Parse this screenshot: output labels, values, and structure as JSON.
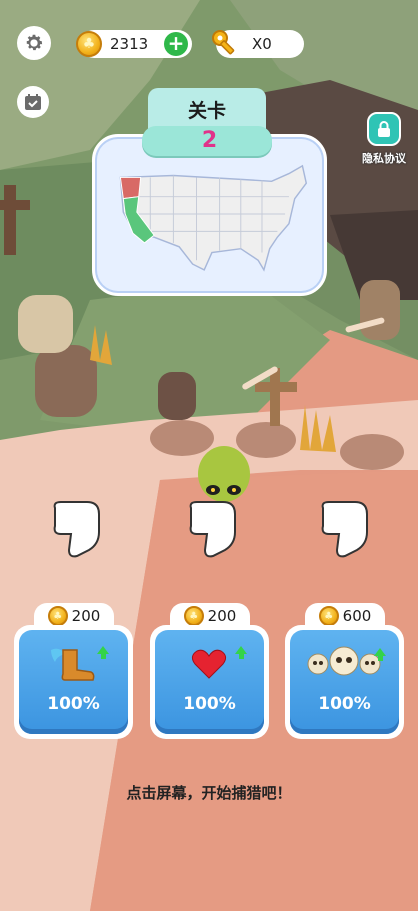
{
  "hud": {
    "settings_icon": "gear-icon",
    "coins": "2313",
    "add_icon": "plus-icon",
    "keys": "X0",
    "key_icon": "key-icon",
    "calendar_icon": "calendar-check-icon"
  },
  "level": {
    "title": "关卡",
    "number": "2",
    "map": "usa-map"
  },
  "privacy": {
    "label": "隐私协议",
    "icon": "lock-icon"
  },
  "upgrades": [
    {
      "price": "200",
      "icon": "winged-boot-icon",
      "percent": "100%"
    },
    {
      "price": "200",
      "icon": "heart-icon",
      "percent": "100%"
    },
    {
      "price": "600",
      "icon": "skulls-icon",
      "percent": "100%"
    }
  ],
  "hint": "点击屏幕，开始捕猎吧！",
  "colors": {
    "accent_green": "#34d34a",
    "card_blue": "#4aa3ea",
    "level_pink": "#e0338a",
    "teal": "#2fc4b5"
  }
}
